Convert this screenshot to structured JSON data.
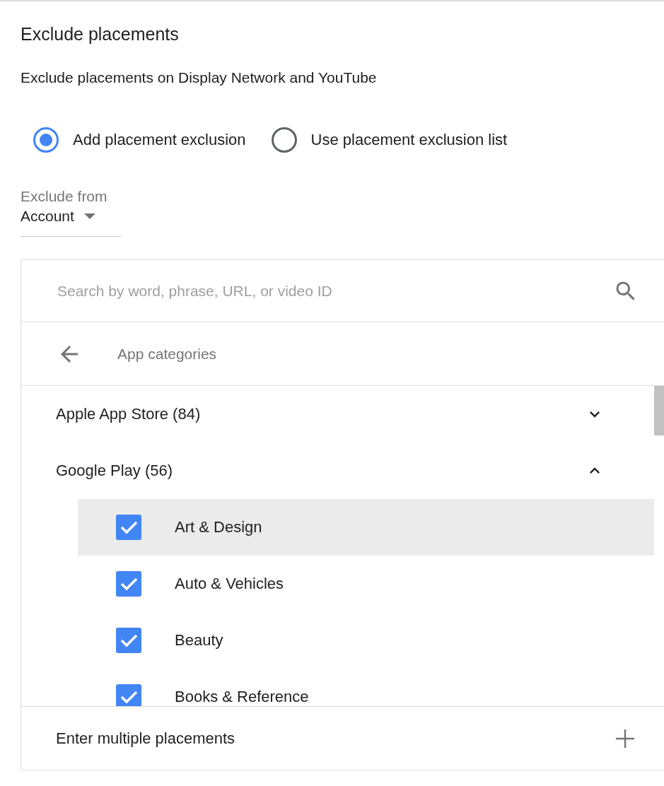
{
  "title": "Exclude placements",
  "subtitle": "Exclude placements on Display Network and YouTube",
  "radios": [
    {
      "label": "Add placement exclusion",
      "selected": true
    },
    {
      "label": "Use placement exclusion list",
      "selected": false
    }
  ],
  "exclude_from": {
    "label": "Exclude from",
    "value": "Account"
  },
  "search": {
    "placeholder": "Search by word, phrase, URL, or video ID"
  },
  "nav": {
    "title": "App categories"
  },
  "categories": [
    {
      "label": "Apple App Store (84)",
      "expanded": false
    },
    {
      "label": "Google Play (56)",
      "expanded": true,
      "children": [
        {
          "label": "Art & Design",
          "checked": true,
          "selected": true
        },
        {
          "label": "Auto & Vehicles",
          "checked": true,
          "selected": false
        },
        {
          "label": "Beauty",
          "checked": true,
          "selected": false
        },
        {
          "label": "Books & Reference",
          "checked": true,
          "selected": false
        }
      ]
    }
  ],
  "footer": {
    "label": "Enter multiple placements"
  }
}
